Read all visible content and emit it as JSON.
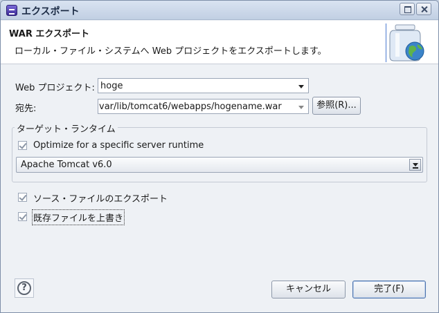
{
  "window": {
    "title": "エクスポート"
  },
  "header": {
    "title": "WAR エクスポート",
    "description": "ローカル・ファイル・システムへ Web プロジェクトをエクスポートします。",
    "icon": "jar-globe-icon"
  },
  "form": {
    "web_project_label": "Web プロジェクト:",
    "web_project_value": "hoge",
    "destination_label": "宛先:",
    "destination_value": "var/lib/tomcat6/webapps/hogename.war",
    "browse_label": "参照(R)..."
  },
  "target_runtime": {
    "group_title": "ターゲット・ランタイム",
    "optimize_label": "Optimize for a specific server runtime",
    "optimize_checked": true,
    "runtime_value": "Apache Tomcat v6.0"
  },
  "options": {
    "export_source_label": "ソース・ファイルのエクスポート",
    "export_source_checked": true,
    "overwrite_label": "既存ファイルを上書き",
    "overwrite_checked": true
  },
  "footer": {
    "help_icon": "question-mark-icon",
    "cancel_label": "キャンセル",
    "finish_label": "完了(F)"
  }
}
